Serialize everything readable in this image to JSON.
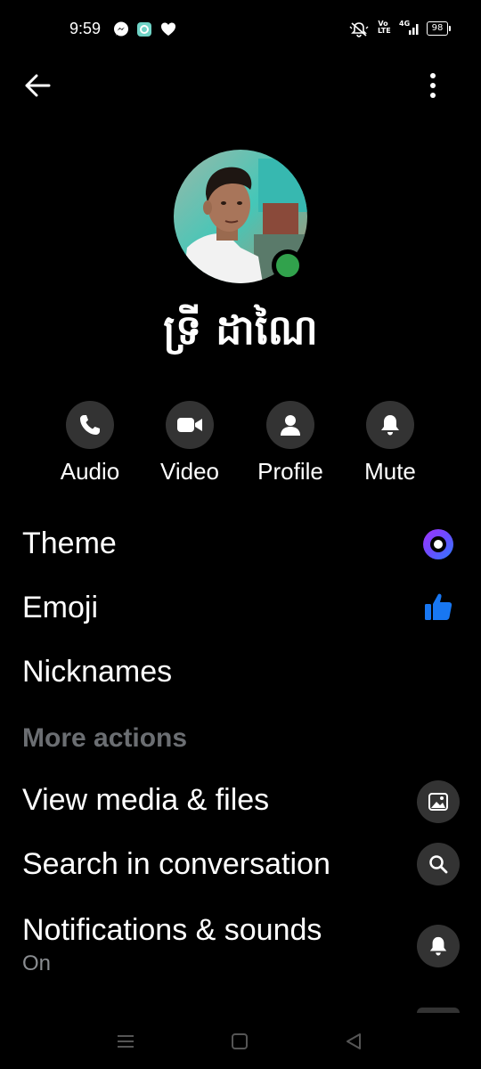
{
  "status_bar": {
    "time": "9:59",
    "battery": "98",
    "volte": "Vo LTE",
    "network": "4G"
  },
  "header": {
    "back_icon": "arrow-left-icon",
    "more_icon": "vertical-dots-icon"
  },
  "profile": {
    "name": "ទ្រី ដាណៃ",
    "online": true,
    "online_color": "#31a24c"
  },
  "actions": [
    {
      "label": "Audio",
      "icon": "phone-icon"
    },
    {
      "label": "Video",
      "icon": "video-camera-icon"
    },
    {
      "label": "Profile",
      "icon": "person-icon"
    },
    {
      "label": "Mute",
      "icon": "bell-icon"
    }
  ],
  "settings": {
    "theme": {
      "label": "Theme",
      "icon": "theme-circle-icon"
    },
    "emoji": {
      "label": "Emoji",
      "icon": "thumbs-up-icon",
      "color": "#1877f2"
    },
    "nicknames": {
      "label": "Nicknames"
    }
  },
  "more_actions": {
    "header": "More actions",
    "items": [
      {
        "label": "View media & files",
        "icon": "image-icon"
      },
      {
        "label": "Search in conversation",
        "icon": "search-icon"
      },
      {
        "label": "Notifications & sounds",
        "sublabel": "On",
        "icon": "bell-icon"
      }
    ]
  },
  "colors": {
    "background": "#000000",
    "circle_bg": "#333333",
    "section_header": "#6b6e72",
    "accent_blue": "#1877f2"
  }
}
